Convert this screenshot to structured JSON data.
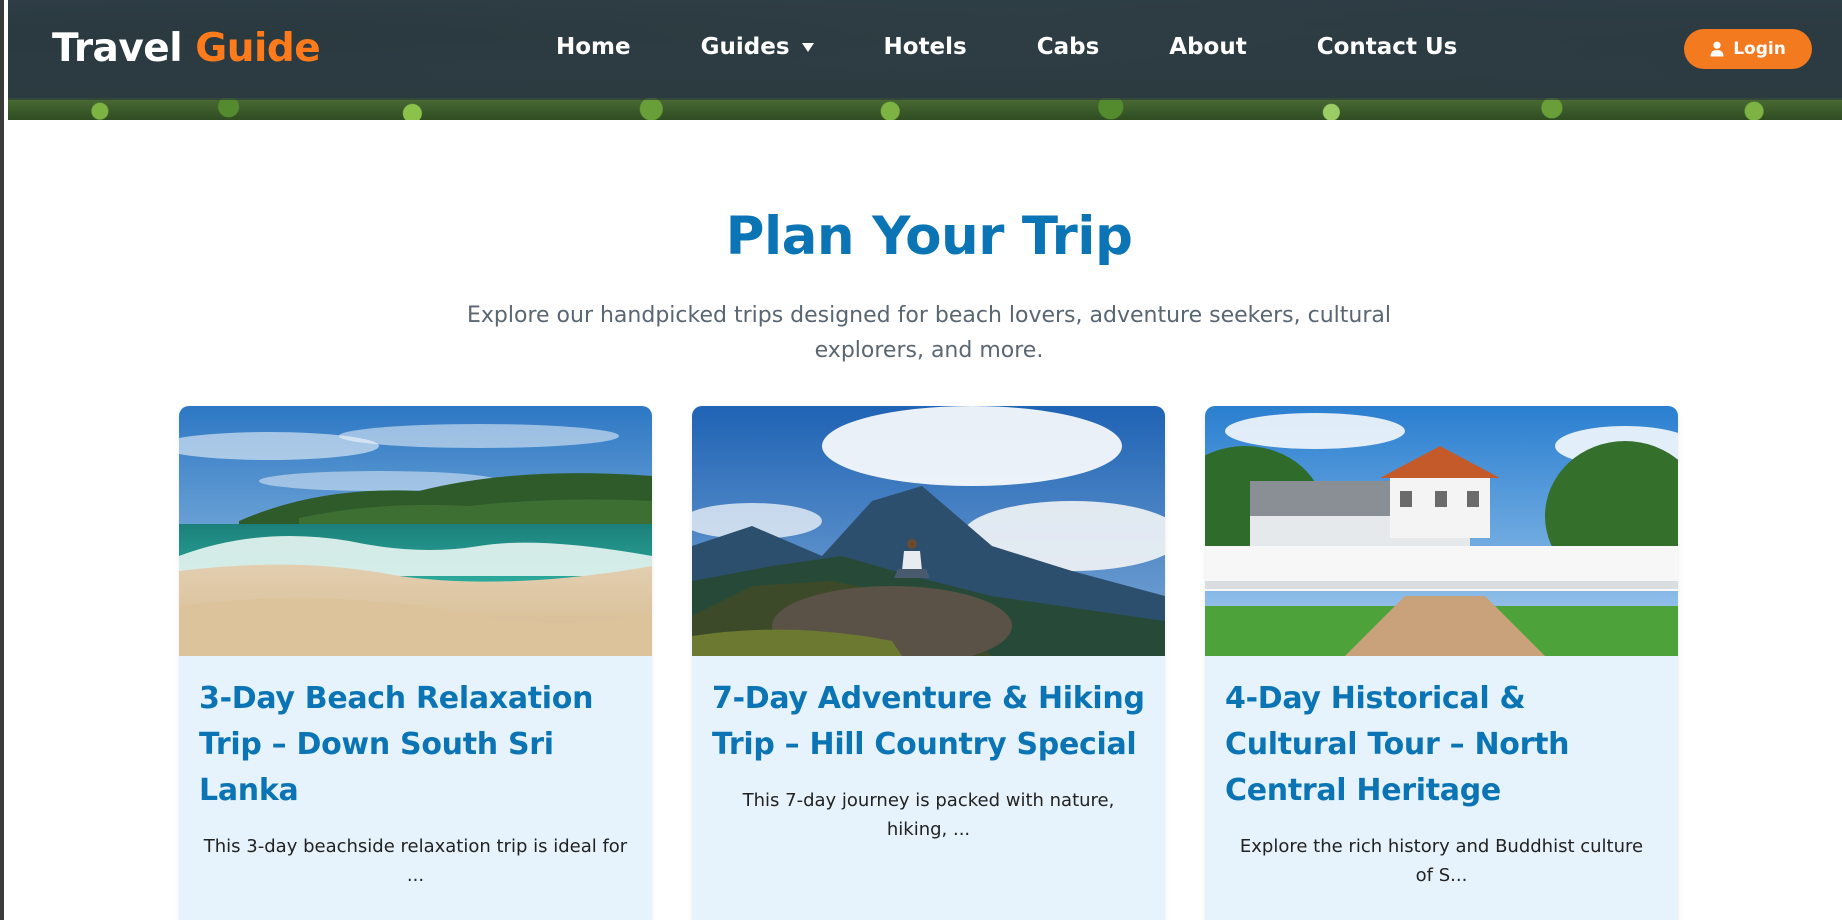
{
  "header": {
    "logo_main": "Travel",
    "logo_accent": "Guide",
    "nav": {
      "home": "Home",
      "guides": "Guides",
      "hotels": "Hotels",
      "cabs": "Cabs",
      "about": "About",
      "contact": "Contact Us"
    },
    "login_label": "Login"
  },
  "main": {
    "title": "Plan Your Trip",
    "subtitle": "Explore our handpicked trips designed for beach lovers, adventure seekers, cultural explorers, and more.",
    "cards": [
      {
        "title": "3-Day Beach Relaxation Trip – Down South Sri Lanka",
        "description": "This 3-day beachside relaxation trip is ideal for ..."
      },
      {
        "title": "7-Day Adventure & Hiking Trip – Hill Country Special",
        "description": "This 7-day journey is packed with nature, hiking, ..."
      },
      {
        "title": "4-Day Historical & Cultural Tour – North Central Heritage",
        "description": "Explore the rich history and Buddhist culture of S..."
      }
    ]
  },
  "colors": {
    "brand_blue": "#0b74b5",
    "accent_orange": "#f47a1f",
    "card_background": "#e6f3fc"
  }
}
